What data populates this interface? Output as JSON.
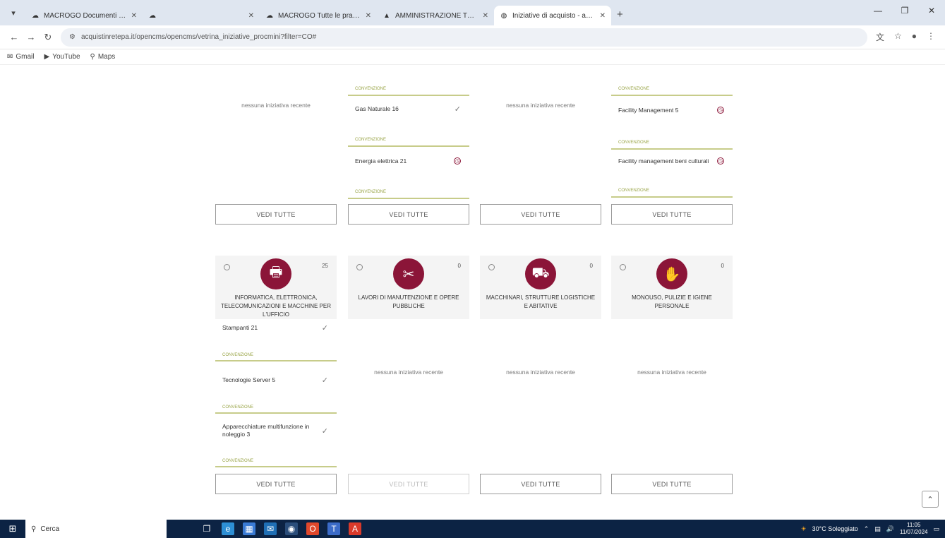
{
  "browser": {
    "tabs": [
      {
        "title": "MACROGO Documenti proc.",
        "favicon": "cloud-icon",
        "active": false
      },
      {
        "title": "",
        "favicon": "cloud-icon",
        "active": false
      },
      {
        "title": "MACROGO Tutte le pratiche",
        "favicon": "cloud-icon",
        "active": false
      },
      {
        "title": "AMMINISTRAZIONE TRASPARENTE",
        "favicon": "drive-icon",
        "active": false
      },
      {
        "title": "Iniziative di acquisto - acquisti",
        "favicon": "globe-icon",
        "active": true
      }
    ],
    "new_tab": "+",
    "url": "acquistinretepa.it/opencms/opencms/vetrina_iniziative_procmini?filter=CO#",
    "bookmarks": [
      "Gmail",
      "YouTube",
      "Maps"
    ]
  },
  "top_row": [
    {
      "empty_msg": "nessuna iniziativa recente",
      "items": [],
      "button": "VEDI TUTTE"
    },
    {
      "empty_msg": "",
      "items": [
        {
          "label_above": "CONVENZIONE",
          "name": "Gas Naturale 16",
          "mark": "check"
        },
        {
          "label_above": "CONVENZIONE",
          "name": "Energia elettrica 21",
          "mark": "pending"
        }
      ],
      "label_below": "CONVENZIONE",
      "button": "VEDI TUTTE"
    },
    {
      "empty_msg": "nessuna iniziativa recente",
      "items": [],
      "button": "VEDI TUTTE"
    },
    {
      "empty_msg": "",
      "items": [
        {
          "label_above": "CONVENZIONE",
          "name": "Facility Management 5",
          "mark": "pending"
        },
        {
          "label_above": "CONVENZIONE",
          "name": "Facility management beni culturali",
          "mark": "pending"
        }
      ],
      "label_below": "CONVENZIONE",
      "button": "VEDI TUTTE"
    }
  ],
  "categories": [
    {
      "title": "INFORMATICA, ELETTRONICA, TELECOMUNICAZIONI E MACCHINE PER L'UFFICIO",
      "count": "25",
      "icon": "printer-icon",
      "items": [
        {
          "name": "Stampanti 21",
          "mark": "check",
          "label_below": "CONVENZIONE"
        },
        {
          "name": "Tecnologie Server 5",
          "mark": "check",
          "label_below": "CONVENZIONE"
        },
        {
          "name": "Apparecchiature multifunzione in noleggio 3",
          "mark": "check",
          "label_below": "CONVENZIONE"
        }
      ],
      "empty_msg": "",
      "button": "VEDI TUTTE",
      "button_disabled": false
    },
    {
      "title": "LAVORI DI MANUTENZIONE E OPERE PUBBLICHE",
      "count": "0",
      "icon": "tools-icon",
      "items": [],
      "empty_msg": "nessuna iniziativa recente",
      "button": "VEDI TUTTE",
      "button_disabled": true
    },
    {
      "title": "MACCHINARI, STRUTTURE LOGISTICHE E ABITATIVE",
      "count": "0",
      "icon": "truck-icon",
      "items": [],
      "empty_msg": "nessuna iniziativa recente",
      "button": "VEDI TUTTE",
      "button_disabled": false
    },
    {
      "title": "MONOUSO, PULIZIE E IGIENE PERSONALE",
      "count": "0",
      "icon": "hygiene-icon",
      "items": [],
      "empty_msg": "nessuna iniziativa recente",
      "button": "VEDI TUTTE",
      "button_disabled": false
    }
  ],
  "taskbar": {
    "search_placeholder": "Cerca",
    "weather": "30°C Soleggiato",
    "time": "11:05",
    "date": "11/07/2024"
  },
  "colors": {
    "accent": "#8b1538",
    "label": "#9aa548",
    "taskbar": "#0c2344"
  }
}
